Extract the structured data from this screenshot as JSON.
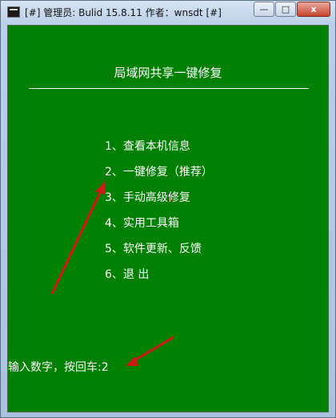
{
  "window": {
    "title": "[#] 管理员:  Bulid 15.8.11   作者：wnsdt [#]",
    "controls": {
      "minimize": "—",
      "maximize": "□",
      "close": "x"
    }
  },
  "console": {
    "background_color": "#008000",
    "text_color": "#ffffff",
    "heading": "局域网共享一键修复",
    "menu": [
      {
        "label": "1、查看本机信息"
      },
      {
        "label": "2、一键修复（推荐）"
      },
      {
        "label": "3、手动高级修复"
      },
      {
        "label": "4、实用工具箱"
      },
      {
        "label": "5、软件更新、反馈"
      },
      {
        "label": "6、退    出"
      }
    ],
    "prompt": "输入数字，按回车:2"
  },
  "annotations": {
    "arrow_color": "#d01818"
  }
}
